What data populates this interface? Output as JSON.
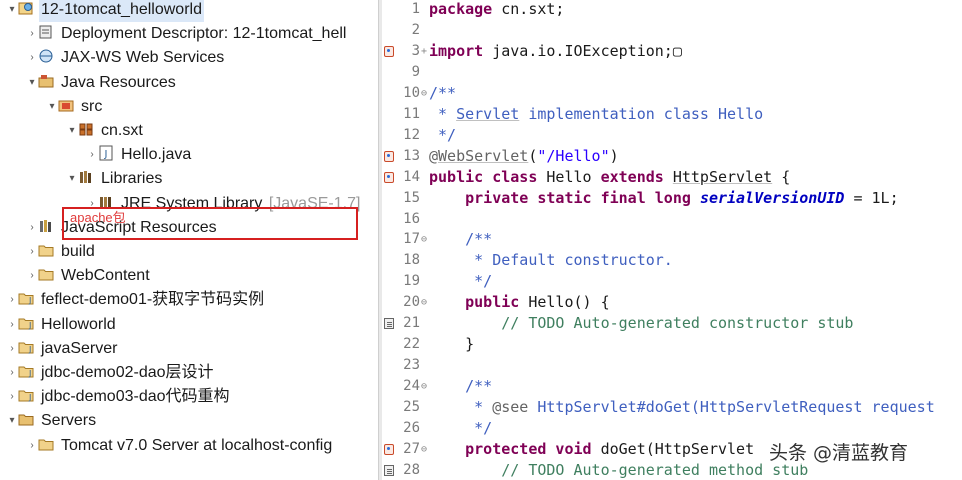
{
  "explorer": {
    "items": [
      {
        "label": "12-1tomcat_helloworld",
        "arrow": "▾",
        "icon": "web-project-icon",
        "selected": true
      },
      {
        "label": "Deployment Descriptor: 12-1tomcat_hell",
        "arrow": "›",
        "icon": "deployment-descriptor-icon"
      },
      {
        "label": "JAX-WS Web Services",
        "arrow": "›",
        "icon": "web-services-icon"
      },
      {
        "label": "Java Resources",
        "arrow": "▾",
        "icon": "java-resources-icon"
      },
      {
        "label": "src",
        "arrow": "▾",
        "icon": "source-folder-icon"
      },
      {
        "label": "cn.sxt",
        "arrow": "▾",
        "icon": "package-icon"
      },
      {
        "label": "Hello.java",
        "arrow": "›",
        "icon": "java-file-icon"
      },
      {
        "label": "Libraries",
        "arrow": "▾",
        "icon": "libraries-icon"
      },
      {
        "label": "JRE System Library",
        "suffix": "[JavaSE-1.7]",
        "arrow": "›",
        "icon": "library-icon"
      },
      {
        "label": "JavaScript Resources",
        "arrow": "›",
        "icon": "javascript-resources-icon"
      },
      {
        "label": "build",
        "arrow": "›",
        "icon": "folder-icon"
      },
      {
        "label": "WebContent",
        "arrow": "›",
        "icon": "folder-icon"
      },
      {
        "label": "feflect-demo01-获取字节码实例",
        "arrow": "›",
        "icon": "java-project-icon"
      },
      {
        "label": "Helloworld",
        "arrow": "›",
        "icon": "java-project-icon"
      },
      {
        "label": "javaServer",
        "arrow": "›",
        "icon": "java-project-icon"
      },
      {
        "label": "jdbc-demo02-dao层设计",
        "arrow": "›",
        "icon": "java-project-icon"
      },
      {
        "label": "jdbc-demo03-dao代码重构",
        "arrow": "›",
        "icon": "java-project-icon"
      },
      {
        "label": "Servers",
        "arrow": "▾",
        "icon": "servers-folder-icon"
      },
      {
        "label": "Tomcat v7.0 Server at localhost-config",
        "arrow": "›",
        "icon": "folder-icon"
      }
    ],
    "annotation": "apache包"
  },
  "editor": {
    "lines": [
      {
        "n": "1",
        "tokens": [
          {
            "t": "package",
            "c": "k"
          },
          {
            "t": " cn.sxt;"
          }
        ]
      },
      {
        "n": "2",
        "tokens": []
      },
      {
        "n": "3",
        "marker": "bp",
        "fold": "+",
        "tokens": [
          {
            "t": "import",
            "c": "k"
          },
          {
            "t": " java.io.IOException;▢"
          }
        ]
      },
      {
        "n": "9",
        "tokens": []
      },
      {
        "n": "10",
        "fold": "⊖",
        "tokens": [
          {
            "t": "/**",
            "c": "cm"
          }
        ]
      },
      {
        "n": "11",
        "tokens": [
          {
            "t": " * ",
            "c": "cm"
          },
          {
            "t": "Servlet",
            "c": "cm u"
          },
          {
            "t": " implementation class Hello",
            "c": "cm"
          }
        ]
      },
      {
        "n": "12",
        "tokens": [
          {
            "t": " */",
            "c": "cm"
          }
        ]
      },
      {
        "n": "13",
        "marker": "bp",
        "tokens": [
          {
            "t": "@",
            "c": "an"
          },
          {
            "t": "WebServlet",
            "c": "an u"
          },
          {
            "t": "("
          },
          {
            "t": "\"/Hello\"",
            "c": "sl"
          },
          {
            "t": ")"
          }
        ]
      },
      {
        "n": "14",
        "marker": "bp",
        "tokens": [
          {
            "t": "public class",
            "c": "k"
          },
          {
            "t": " Hello "
          },
          {
            "t": "extends",
            "c": "k"
          },
          {
            "t": " "
          },
          {
            "t": "HttpServlet",
            "c": "u"
          },
          {
            "t": " {"
          }
        ]
      },
      {
        "n": "15",
        "tokens": [
          {
            "t": "    "
          },
          {
            "t": "private static final long",
            "c": "k"
          },
          {
            "t": " "
          },
          {
            "t": "serialVersionUID",
            "c": "fi"
          },
          {
            "t": " = 1L;"
          }
        ]
      },
      {
        "n": "16",
        "tokens": []
      },
      {
        "n": "17",
        "fold": "⊖",
        "tokens": [
          {
            "t": "    "
          },
          {
            "t": "/**",
            "c": "cm"
          }
        ]
      },
      {
        "n": "18",
        "tokens": [
          {
            "t": "     * Default constructor.",
            "c": "cm"
          }
        ]
      },
      {
        "n": "19",
        "tokens": [
          {
            "t": "     */",
            "c": "cm"
          }
        ]
      },
      {
        "n": "20",
        "fold": "⊖",
        "tokens": [
          {
            "t": "    "
          },
          {
            "t": "public",
            "c": "k"
          },
          {
            "t": " Hello() {"
          }
        ]
      },
      {
        "n": "21",
        "marker": "task",
        "tokens": [
          {
            "t": "        "
          },
          {
            "t": "// TODO Auto-generated constructor stub",
            "c": "ct"
          }
        ]
      },
      {
        "n": "22",
        "tokens": [
          {
            "t": "    }"
          }
        ]
      },
      {
        "n": "23",
        "tokens": []
      },
      {
        "n": "24",
        "fold": "⊖",
        "tokens": [
          {
            "t": "    "
          },
          {
            "t": "/**",
            "c": "cm"
          }
        ]
      },
      {
        "n": "25",
        "tokens": [
          {
            "t": "     * ",
            "c": "cm"
          },
          {
            "t": "@see",
            "c": "an"
          },
          {
            "t": " HttpServlet#doGet(HttpServletRequest request",
            "c": "cm"
          }
        ]
      },
      {
        "n": "26",
        "tokens": [
          {
            "t": "     */",
            "c": "cm"
          }
        ]
      },
      {
        "n": "27",
        "marker": "bp",
        "fold": "⊖",
        "tokens": [
          {
            "t": "    "
          },
          {
            "t": "protected void",
            "c": "k"
          },
          {
            "t": " doGet(HttpServlet"
          }
        ]
      },
      {
        "n": "28",
        "marker": "task",
        "tokens": [
          {
            "t": "        "
          },
          {
            "t": "// TODO Auto-generated method stub",
            "c": "ct"
          }
        ]
      }
    ]
  },
  "watermark": "头条 @清蓝教育"
}
